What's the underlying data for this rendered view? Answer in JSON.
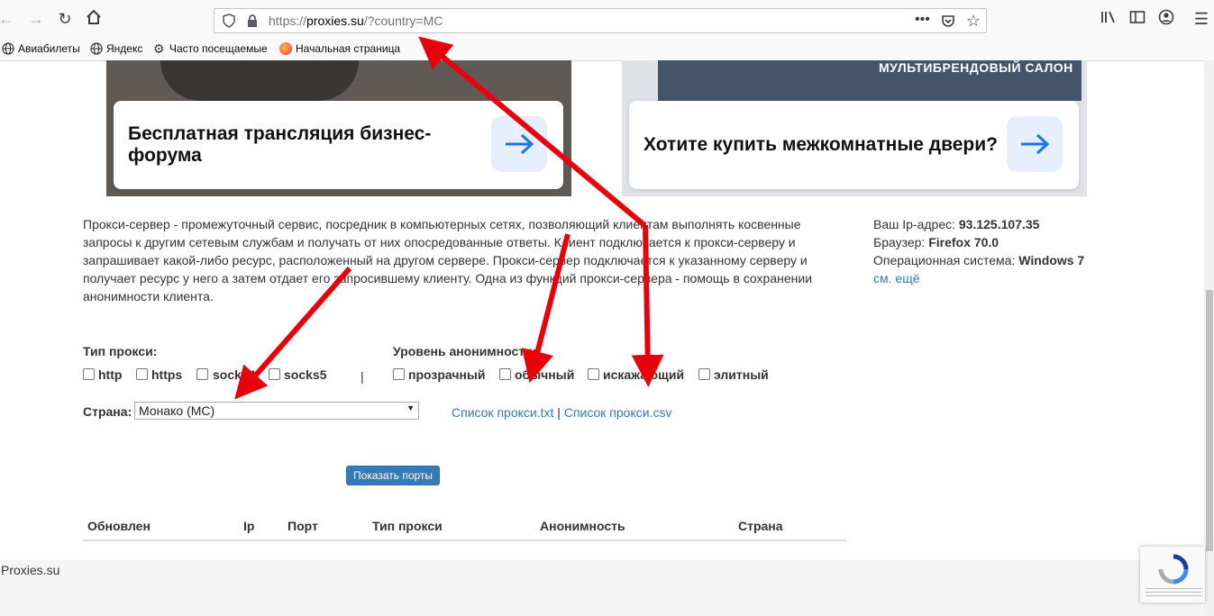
{
  "browser": {
    "url_prefix": "https://",
    "url_host": "proxies.su",
    "url_path": "/?country=MC",
    "bookmarks": [
      "Авиабилеты",
      "Яндекс",
      "Часто посещаемые",
      "Начальная страница"
    ]
  },
  "ads": [
    {
      "title": "Бесплатная трансляция бизнес-форума"
    },
    {
      "title": "Хотите купить межкомнатные двери?",
      "banner_text": "МУЛЬТИБРЕНДОВЫЙ САЛОН"
    }
  ],
  "intro": {
    "lines": [
      "Прокси-сервер - промежуточный сервис, посредник в компьютерных сетях, позволяющий клиентам выполнять косвенные",
      "запросы к другим сетевым службам и получать от них опосредованные ответы. Клиент подключается к прокси-серверу и",
      "запрашивает какой-либо ресурс, расположенный на другом сервере. Прокси-сервер подключается к указанному серверу и",
      "получает ресурс у него а затем отдает его запросившему клиенту. Одна из функций прокси-сервера - помощь в сохранении",
      "анонимности клиента."
    ]
  },
  "client_info": {
    "ip_label": "Ваш Ip-адрес:",
    "ip_value": "93.125.107.35",
    "browser_label": "Браузер:",
    "browser_value": "Firefox 70.0",
    "os_label": "Операционная система:",
    "os_value": "Windows 7",
    "more_link": "см. ещё"
  },
  "filters": {
    "proxy_type_label": "Тип прокси:",
    "proxy_types": [
      "http",
      "https",
      "socks4",
      "socks5"
    ],
    "separator": "|",
    "anonymity_label": "Уровень анонимности:",
    "anonymity_levels": [
      "прозрачный",
      "обычный",
      "искажающий",
      "элитный"
    ],
    "country_label": "Страна:",
    "country_selected": "Монако (MC)",
    "link_txt": "Список прокси.txt",
    "link_sep": "|",
    "link_csv": "Список прокси.csv",
    "show_ports_button": "Показать порты"
  },
  "table": {
    "headers": [
      "Обновлен",
      "Ip",
      "Порт",
      "Тип прокси",
      "Анонимность",
      "Страна"
    ]
  },
  "footer": {
    "site_name": "Proxies.su"
  },
  "colors": {
    "link": "#337ab7",
    "button": "#337ab7",
    "annotation_arrow": "#e8000b"
  }
}
